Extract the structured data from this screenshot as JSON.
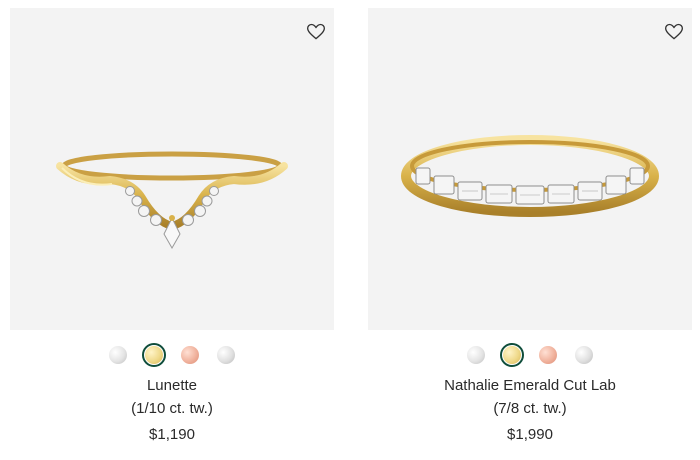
{
  "products": [
    {
      "name": "Lunette",
      "weight": "(1/10 ct. tw.)",
      "price": "$1,190",
      "swatches": [
        "white-gold",
        "yellow-gold",
        "rose-gold",
        "platinum"
      ],
      "selected_swatch": "yellow-gold"
    },
    {
      "name": "Nathalie Emerald Cut Lab",
      "weight": "(7/8 ct. tw.)",
      "price": "$1,990",
      "swatches": [
        "white-gold",
        "yellow-gold",
        "rose-gold",
        "platinum"
      ],
      "selected_swatch": "yellow-gold"
    }
  ],
  "colors": {
    "selected_ring": "#0f4d3b",
    "image_background": "#f3f3f3",
    "gold": "#d9b24a"
  },
  "icons": {
    "wishlist": "heart-outline-icon"
  }
}
